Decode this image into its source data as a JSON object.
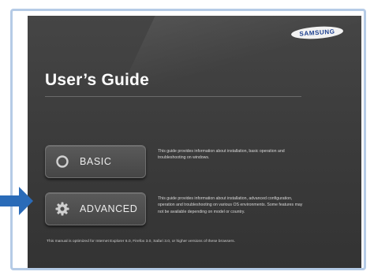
{
  "brand": {
    "name": "SAMSUNG"
  },
  "page": {
    "title": "User’s Guide"
  },
  "buttons": {
    "basic": {
      "label": "BASIC",
      "icon": "circle-icon"
    },
    "advanced": {
      "label": "ADVANCED",
      "icon": "gear-icon"
    }
  },
  "descriptions": {
    "basic": "This guide provides information about installation, basic operation and troubleshooting on windows.",
    "advanced": "This guide provides information about installation, advanced configuration, operation and troubleshooting on various OS environments. Some features may not be available depending on model or country."
  },
  "footer": {
    "text": "This manual is optimized for Internet Explorer 6.0, Firefox 3.0, Safari 3.0, or higher versions of these browsers."
  },
  "colors": {
    "arrow": "#2a6bb8",
    "frame_border": "#b5cbe6",
    "panel": "#3d3d3d",
    "logo_text": "#1c3f8f"
  }
}
